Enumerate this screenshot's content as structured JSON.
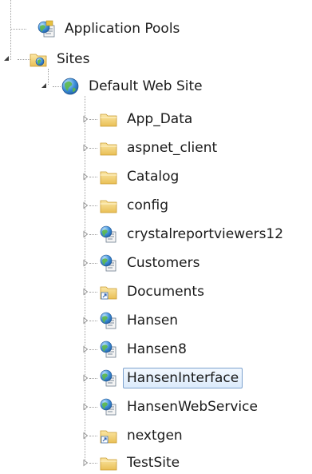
{
  "tree": {
    "application_pools": {
      "label": "Application Pools",
      "icon": "app-pool-icon"
    },
    "sites": {
      "label": "Sites",
      "icon": "sites-folder-icon",
      "expanded": true,
      "default_web_site": {
        "label": "Default Web Site",
        "icon": "globe-site-icon",
        "expanded": true,
        "children": [
          {
            "label": "App_Data",
            "icon": "folder-icon"
          },
          {
            "label": "aspnet_client",
            "icon": "folder-icon"
          },
          {
            "label": "Catalog",
            "icon": "folder-icon"
          },
          {
            "label": "config",
            "icon": "folder-icon"
          },
          {
            "label": "crystalreportviewers12",
            "icon": "web-application-icon"
          },
          {
            "label": "Customers",
            "icon": "web-application-icon"
          },
          {
            "label": "Documents",
            "icon": "virtual-directory-icon"
          },
          {
            "label": "Hansen",
            "icon": "web-application-icon"
          },
          {
            "label": "Hansen8",
            "icon": "web-application-icon"
          },
          {
            "label": "HansenInterface",
            "icon": "web-application-icon",
            "selected": true
          },
          {
            "label": "HansenWebService",
            "icon": "web-application-icon"
          },
          {
            "label": "nextgen",
            "icon": "virtual-directory-icon"
          },
          {
            "label": "TestSite",
            "icon": "folder-icon"
          }
        ]
      }
    }
  },
  "colors": {
    "selection_border": "#7da2ce",
    "selection_fill": "#dcebfc",
    "folder_yellow": "#f3d27a",
    "connector": "#a0a0a0"
  }
}
